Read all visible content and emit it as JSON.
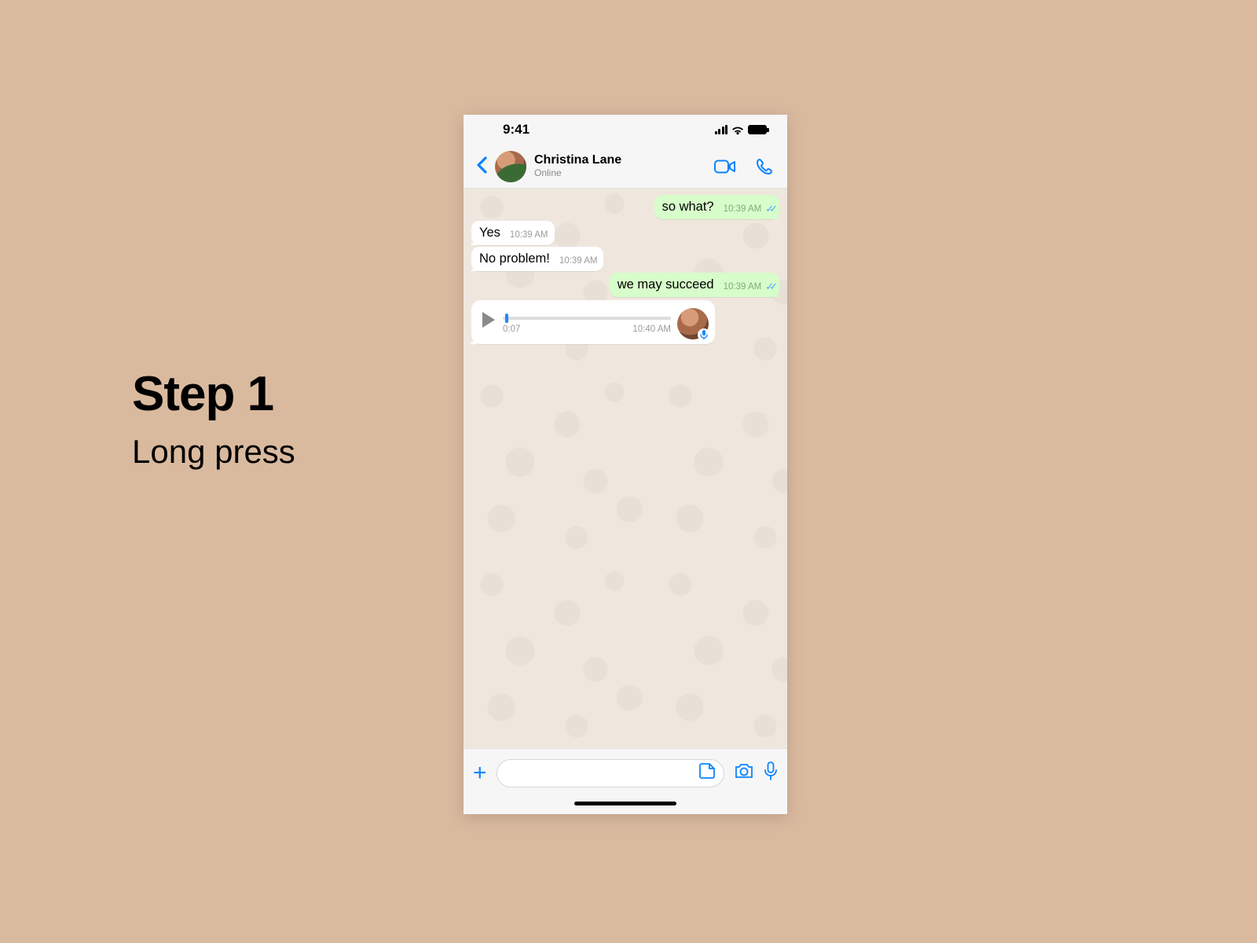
{
  "caption": {
    "title": "Step 1",
    "subtitle": "Long press"
  },
  "statusbar": {
    "time": "9:41"
  },
  "header": {
    "contact_name": "Christina Lane",
    "status": "Online"
  },
  "messages": [
    {
      "side": "out",
      "text": "so what?",
      "time": "10:39 AM",
      "read": true
    },
    {
      "side": "in",
      "text": "Yes",
      "time": "10:39 AM"
    },
    {
      "side": "in",
      "text": "No problem!",
      "time": "10:39 AM"
    },
    {
      "side": "out",
      "text": "we may succeed",
      "time": "10:39 AM",
      "read": true
    }
  ],
  "voice": {
    "duration": "0:07",
    "time": "10:40 AM"
  },
  "input": {
    "placeholder": ""
  }
}
